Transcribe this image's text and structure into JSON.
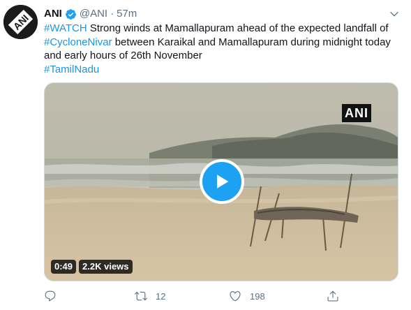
{
  "author": {
    "name": "ANI",
    "handle": "@ANI",
    "separator": "·",
    "time": "57m",
    "avatar_text": "ANI"
  },
  "tweet": {
    "line1_tag": "#WATCH",
    "line1_text": " Strong winds at Mamallapuram ahead of the expected landfall of",
    "line2_tag": "#CycloneNivar",
    "line2_text": " between Karaikal and Mamallapuram during midnight today",
    "line3_text": "and early hours of 26th November",
    "line4_tag": "#TamilNadu"
  },
  "media": {
    "watermark": "ANI",
    "duration": "0:49",
    "views": "2.2K views"
  },
  "actions": {
    "replies": "",
    "retweets": "12",
    "likes": "198"
  },
  "colors": {
    "accent": "#1da1f2",
    "link": "#1b95e0",
    "muted": "#5b7083"
  },
  "icons": [
    "verified-badge-icon",
    "chevron-down-icon",
    "play-icon",
    "reply-icon",
    "retweet-icon",
    "like-icon",
    "share-icon"
  ]
}
